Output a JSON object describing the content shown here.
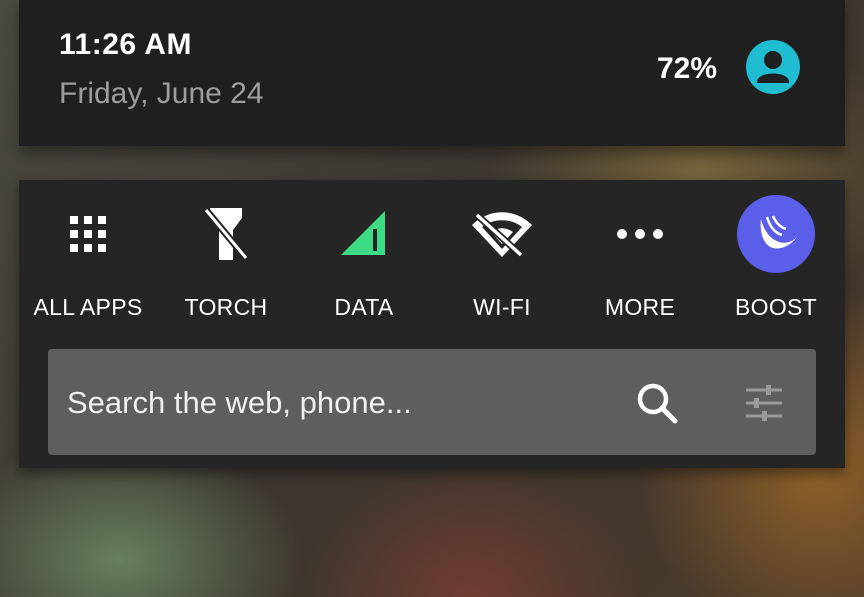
{
  "header": {
    "time": "11:26 AM",
    "date": "Friday, June 24",
    "battery": "72%",
    "avatar_icon": "account-circle-icon"
  },
  "quick_actions": [
    {
      "label": "ALL APPS",
      "icon": "grid-icon"
    },
    {
      "label": "TORCH",
      "icon": "flashlight-off-icon"
    },
    {
      "label": "DATA",
      "icon": "cellular-signal-icon"
    },
    {
      "label": "WI-FI",
      "icon": "wifi-off-icon"
    },
    {
      "label": "MORE",
      "icon": "more-horizontal-icon"
    },
    {
      "label": "BOOST",
      "icon": "boost-bird-icon"
    }
  ],
  "search": {
    "placeholder": "Search the web, phone...",
    "search_icon": "search-icon",
    "settings_icon": "tune-sliders-icon"
  },
  "colors": {
    "accent_teal": "#1fbcd2",
    "data_green": "#3ddc84",
    "boost_purple": "#5b5ee8",
    "card_dark": "#1f1f1f",
    "search_bg": "#5e5e5e"
  }
}
